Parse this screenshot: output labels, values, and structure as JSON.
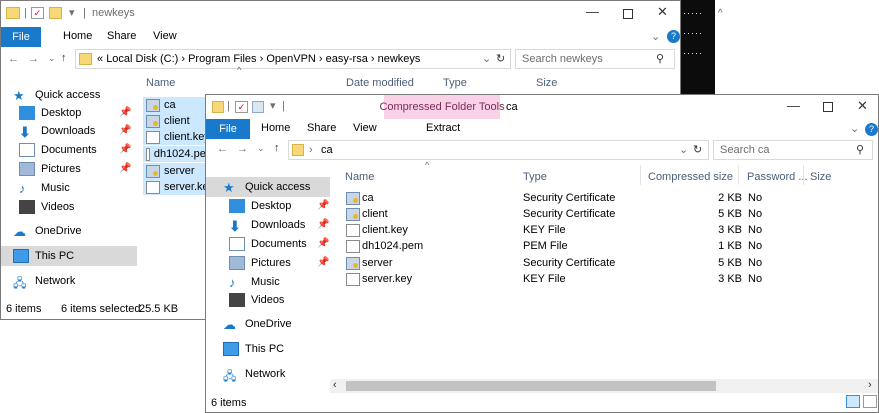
{
  "back_window": {
    "title": "newkeys",
    "menu": {
      "file": "File",
      "home": "Home",
      "share": "Share",
      "view": "View"
    },
    "address": {
      "prefix": "«",
      "parts": [
        "Local Disk (C:)",
        "Program Files",
        "OpenVPN",
        "easy-rsa",
        "newkeys"
      ]
    },
    "search_placeholder": "Search newkeys",
    "columns": {
      "name": "Name",
      "date": "Date modified",
      "type": "Type",
      "size": "Size"
    },
    "nav": [
      "Quick access",
      "Desktop",
      "Downloads",
      "Documents",
      "Pictures",
      "Music",
      "Videos",
      "OneDrive",
      "This PC",
      "Network"
    ],
    "files": [
      "ca",
      "client",
      "client.key",
      "dh1024.pem",
      "server",
      "server.key"
    ],
    "status": {
      "count": "6 items",
      "selected": "6 items selected",
      "size": "25.5 KB"
    }
  },
  "front_window": {
    "context_tab": "Compressed Folder Tools",
    "title": "ca",
    "menu": {
      "file": "File",
      "home": "Home",
      "share": "Share",
      "view": "View",
      "extract": "Extract"
    },
    "address": {
      "part": "ca"
    },
    "search_placeholder": "Search ca",
    "columns": {
      "name": "Name",
      "type": "Type",
      "compressed": "Compressed size",
      "password": "Password ...",
      "size": "Size"
    },
    "nav": [
      "Quick access",
      "Desktop",
      "Downloads",
      "Documents",
      "Pictures",
      "Music",
      "Videos",
      "OneDrive",
      "This PC",
      "Network"
    ],
    "files": [
      {
        "name": "ca",
        "type": "Security Certificate",
        "compressed": "2 KB",
        "password": "No",
        "icon": "certificate-icon"
      },
      {
        "name": "client",
        "type": "Security Certificate",
        "compressed": "5 KB",
        "password": "No",
        "icon": "certificate-icon"
      },
      {
        "name": "client.key",
        "type": "KEY File",
        "compressed": "3 KB",
        "password": "No",
        "icon": "file-icon"
      },
      {
        "name": "dh1024.pem",
        "type": "PEM File",
        "compressed": "1 KB",
        "password": "No",
        "icon": "file-icon"
      },
      {
        "name": "server",
        "type": "Security Certificate",
        "compressed": "5 KB",
        "password": "No",
        "icon": "certificate-icon"
      },
      {
        "name": "server.key",
        "type": "KEY File",
        "compressed": "3 KB",
        "password": "No",
        "icon": "file-icon"
      }
    ],
    "status": {
      "count": "6 items"
    }
  },
  "colors": {
    "accent": "#1979ca",
    "context_tab": "#f9d2e8",
    "selected": "#cce8ff",
    "nav_selected": "#d9d9d9"
  }
}
